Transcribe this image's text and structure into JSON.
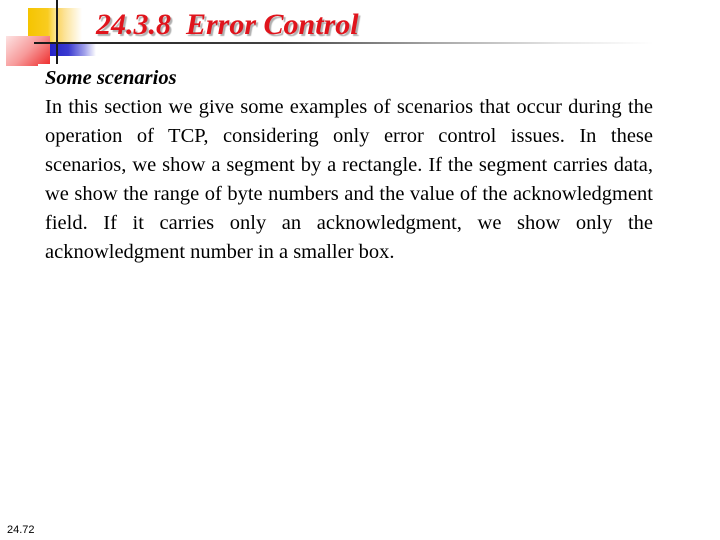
{
  "slide": {
    "title": "24.3.8  Error Control",
    "subheading": "Some scenarios",
    "body": "In this section we give some examples of scenarios that occur during the operation of TCP, considering only error control issues. In these scenarios, we show a segment by a rectangle. If the segment carries data, we show the range of byte numbers and the value of the acknowledgment field. If it carries only an acknowledgment, we show only the acknowledgment number in a smaller box.",
    "slide_number": "24.72"
  },
  "colors": {
    "title": "#e0141c",
    "title_shadow": "#b0b0b0",
    "deco_yellow": "#f5c400",
    "deco_red": "#ee2a2a",
    "deco_blue": "#2323c8",
    "deco_line": "#1a1a1a"
  }
}
